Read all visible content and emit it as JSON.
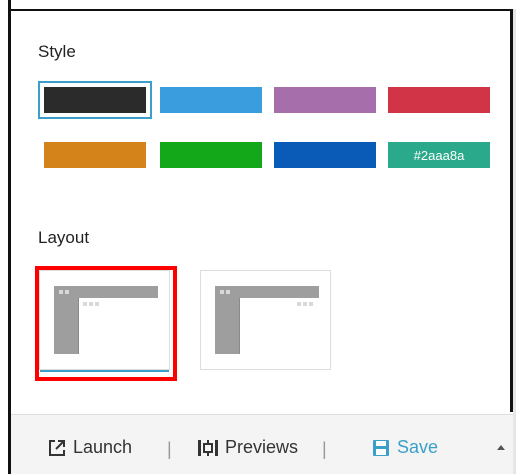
{
  "style_section": {
    "label": "Style",
    "swatches": [
      {
        "color": "#2b2b2b",
        "selected": true
      },
      {
        "color": "#3a9ddd"
      },
      {
        "color": "#a66fac"
      },
      {
        "color": "#d13446"
      },
      {
        "color": "#d4821a"
      },
      {
        "color": "#13a81a"
      },
      {
        "color": "#0a5ab8"
      },
      {
        "color": "#2aaa8a",
        "label": "#2aaa8a"
      }
    ]
  },
  "layout_section": {
    "label": "Layout",
    "options": [
      {
        "name": "layout-sidebar-full",
        "selected": true
      },
      {
        "name": "layout-sidebar-header"
      }
    ]
  },
  "toolbar": {
    "launch_label": "Launch",
    "previews_label": "Previews",
    "save_label": "Save",
    "separator": "|"
  },
  "colors": {
    "accent": "#3aa0c9",
    "highlight": "#ff0000"
  }
}
